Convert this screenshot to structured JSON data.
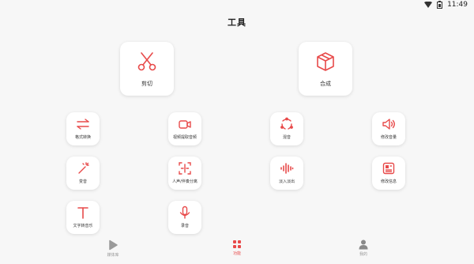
{
  "status": {
    "time": "11:49"
  },
  "header": {
    "title": "工具"
  },
  "main_tools": [
    {
      "label": "剪切",
      "icon": "scissors-icon"
    },
    {
      "label": "合成",
      "icon": "cube-icon"
    }
  ],
  "tools": [
    {
      "label": "格式转换",
      "icon": "swap-arrows-icon"
    },
    {
      "label": "视频提取音频",
      "icon": "video-camera-icon"
    },
    {
      "label": "混音",
      "icon": "mix-circle-icon"
    },
    {
      "label": "修改音量",
      "icon": "volume-icon"
    },
    {
      "label": "变音",
      "icon": "magic-wand-icon"
    },
    {
      "label": "人声/伴奏分离",
      "icon": "split-frame-icon"
    },
    {
      "label": "淡入淡出",
      "icon": "waveform-icon"
    },
    {
      "label": "修改信息",
      "icon": "info-card-icon"
    },
    {
      "label": "文字转音乐",
      "icon": "text-t-icon"
    },
    {
      "label": "录音",
      "icon": "microphone-icon"
    }
  ],
  "nav": [
    {
      "label": "媒体库",
      "icon": "play-icon"
    },
    {
      "label": "功能",
      "icon": "grid-icon",
      "active": true
    },
    {
      "label": "我的",
      "icon": "user-icon"
    }
  ],
  "colors": {
    "accent": "#e84a4a",
    "background": "#f7f7f7",
    "inactive": "#999999"
  }
}
